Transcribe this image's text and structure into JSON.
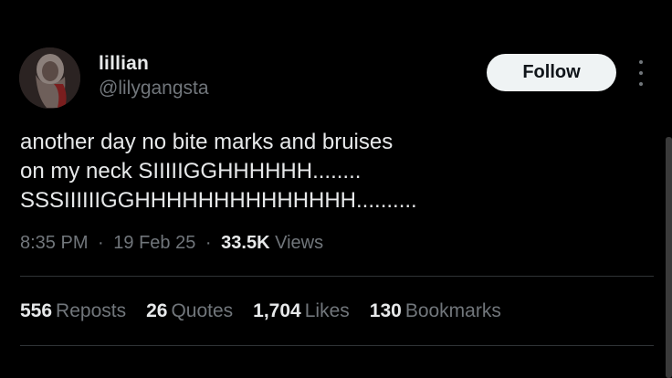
{
  "author": {
    "display_name": "lillian",
    "handle": "@lilygangsta"
  },
  "follow_label": "Follow",
  "tweet": {
    "lines": [
      "another day no bite marks and bruises",
      "on my neck SIIIIIGGHHHHHH........",
      "SSSIIIIIIGGHHHHHHHHHHHHHH.........."
    ]
  },
  "meta": {
    "time": "8:35 PM",
    "date": "19 Feb 25",
    "views_count": "33.5K",
    "views_label": "Views",
    "separator": "·"
  },
  "stats": [
    {
      "count": "556",
      "label": "Reposts"
    },
    {
      "count": "26",
      "label": "Quotes"
    },
    {
      "count": "1,704",
      "label": "Likes"
    },
    {
      "count": "130",
      "label": "Bookmarks"
    }
  ],
  "icons": {
    "more": "more-vertical-icon"
  },
  "colors": {
    "background": "#000000",
    "primary_text": "#e7e9ea",
    "secondary_text": "#71767b",
    "button_bg": "#eff3f4",
    "divider": "#2f3336"
  }
}
